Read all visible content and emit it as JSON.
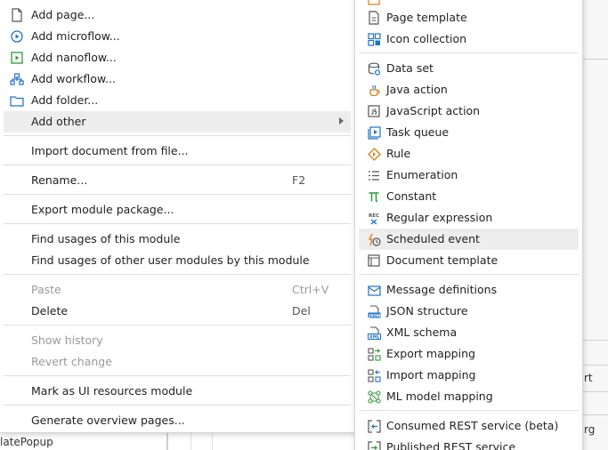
{
  "background": {
    "right_text_top": "rt",
    "right_text_bottom": "rg",
    "bottom_left_text": "latePopup"
  },
  "main_menu": {
    "items": [
      {
        "label": "Add page..."
      },
      {
        "label": "Add microflow..."
      },
      {
        "label": "Add nanoflow..."
      },
      {
        "label": "Add workflow..."
      },
      {
        "label": "Add folder..."
      },
      {
        "label": "Add other"
      },
      {
        "label": "Import document from file..."
      },
      {
        "label": "Rename...",
        "shortcut": "F2"
      },
      {
        "label": "Export module package..."
      },
      {
        "label": "Find usages of this module"
      },
      {
        "label": "Find usages of other user modules by this module"
      },
      {
        "label": "Paste",
        "shortcut": "Ctrl+V"
      },
      {
        "label": "Delete",
        "shortcut": "Del"
      },
      {
        "label": "Show history"
      },
      {
        "label": "Revert change"
      },
      {
        "label": "Mark as UI resources module"
      },
      {
        "label": "Generate overview pages..."
      }
    ]
  },
  "sub_menu": {
    "items": [
      {
        "label": "Page template"
      },
      {
        "label": "Icon collection"
      },
      {
        "label": "Data set"
      },
      {
        "label": "Java action"
      },
      {
        "label": "JavaScript action"
      },
      {
        "label": "Task queue"
      },
      {
        "label": "Rule"
      },
      {
        "label": "Enumeration"
      },
      {
        "label": "Constant"
      },
      {
        "label": "Regular expression"
      },
      {
        "label": "Scheduled event"
      },
      {
        "label": "Document template"
      },
      {
        "label": "Message definitions"
      },
      {
        "label": "JSON structure"
      },
      {
        "label": "XML schema"
      },
      {
        "label": "Export mapping"
      },
      {
        "label": "Import mapping"
      },
      {
        "label": "ML model mapping"
      },
      {
        "label": "Consumed REST service (beta)"
      },
      {
        "label": "Published REST service"
      }
    ]
  },
  "colors": {
    "blue_icon": "#1e73c9",
    "green_icon": "#2e9b3a",
    "orange_icon": "#e07b12",
    "highlight": "#ededed"
  }
}
